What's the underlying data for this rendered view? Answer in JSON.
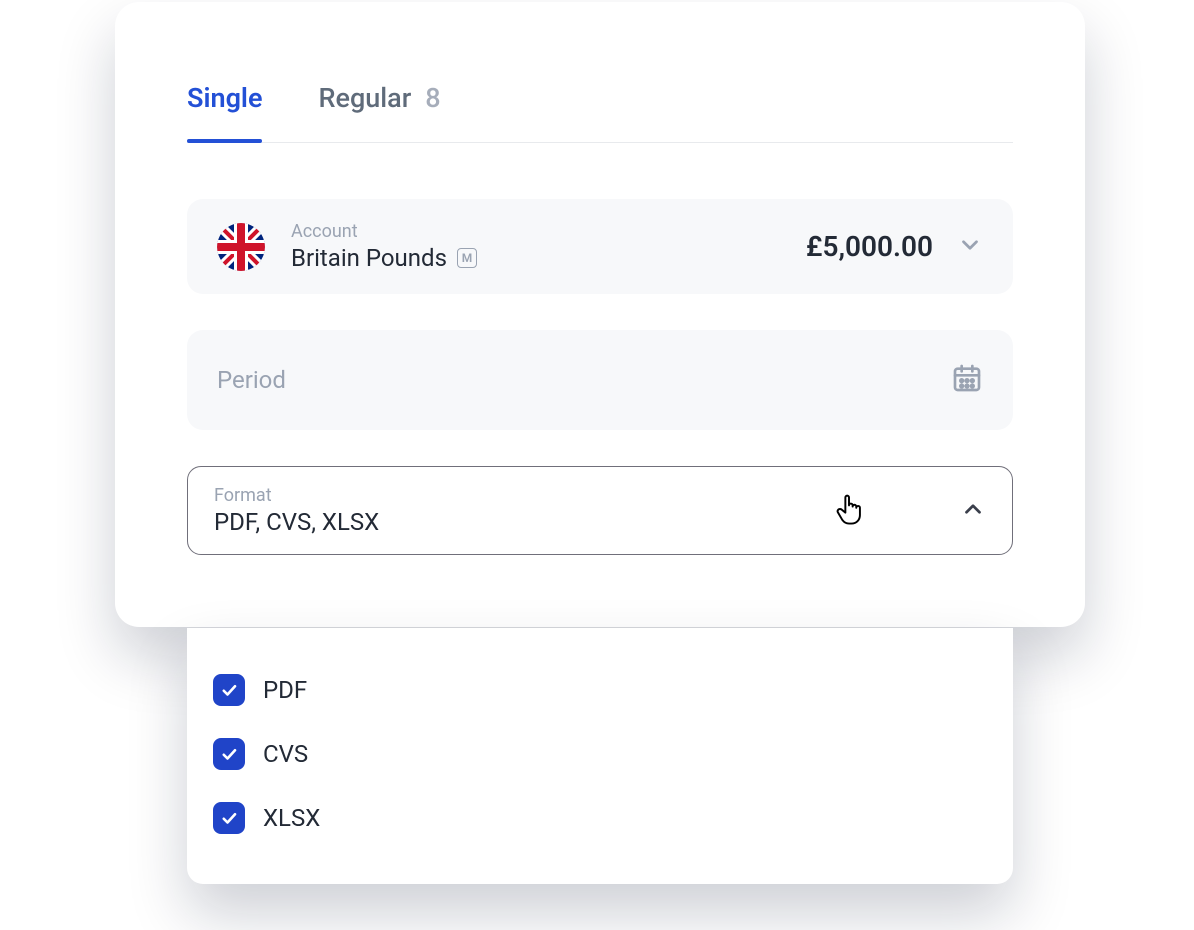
{
  "tabs": {
    "single": "Single",
    "regular": "Regular",
    "regular_count": "8"
  },
  "account": {
    "label": "Account",
    "name": "Britain Pounds",
    "badge": "M",
    "balance": "£5,000.00"
  },
  "period": {
    "label": "Period"
  },
  "format": {
    "label": "Format",
    "value": "PDF, CVS, XLSX",
    "options": [
      "PDF",
      "CVS",
      "XLSX"
    ]
  }
}
